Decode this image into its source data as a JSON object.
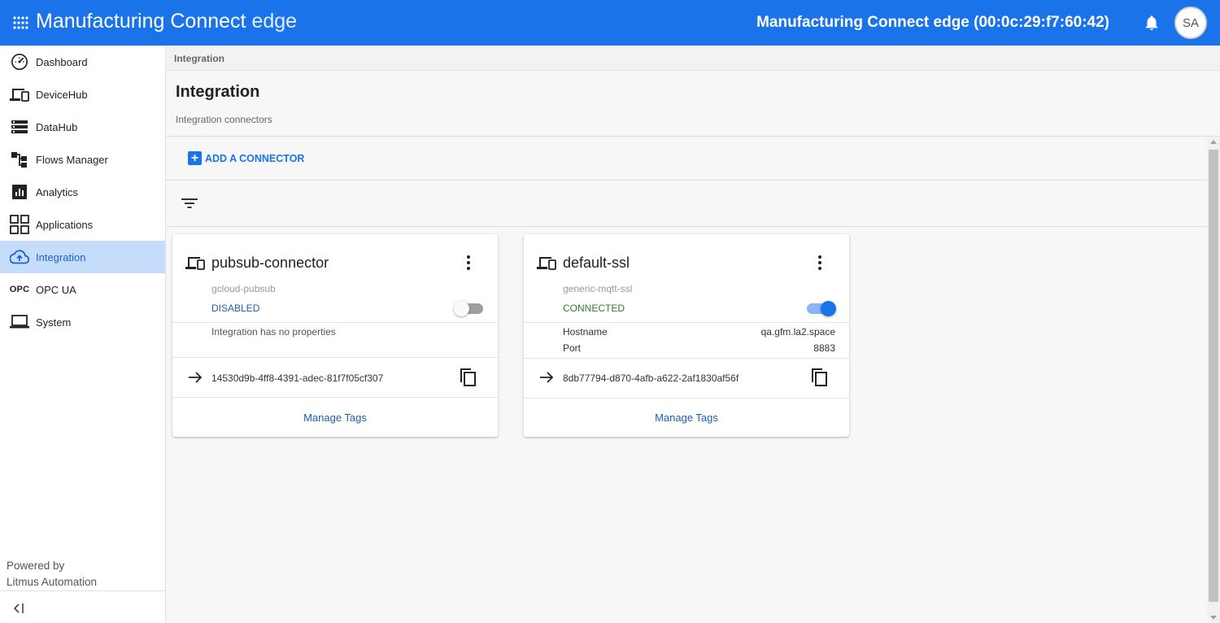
{
  "topbar": {
    "app_title_main": "Manufacturing Connect",
    "app_title_suffix": "edge",
    "device_title": "Manufacturing Connect edge (00:0c:29:f7:60:42)",
    "avatar_initials": "SA",
    "color": "#1a73e8"
  },
  "sidebar": {
    "items": [
      {
        "label": "Dashboard",
        "icon": "speedometer-icon"
      },
      {
        "label": "DeviceHub",
        "icon": "devices-icon"
      },
      {
        "label": "DataHub",
        "icon": "storage-icon"
      },
      {
        "label": "Flows Manager",
        "icon": "flow-icon"
      },
      {
        "label": "Analytics",
        "icon": "analytics-icon"
      },
      {
        "label": "Applications",
        "icon": "apps-grid-icon"
      },
      {
        "label": "Integration",
        "icon": "cloud-upload-icon",
        "active": true
      },
      {
        "label": "OPC UA",
        "icon_text": "OPC"
      },
      {
        "label": "System",
        "icon": "laptop-icon"
      }
    ],
    "powered_by_line1": "Powered by",
    "powered_by_line2": "Litmus Automation"
  },
  "breadcrumb": "Integration",
  "page": {
    "title": "Integration",
    "subtitle": "Integration connectors",
    "add_button_label": "ADD A CONNECTOR"
  },
  "connectors": [
    {
      "name": "pubsub-connector",
      "type": "gcloud-pubsub",
      "status": "DISABLED",
      "enabled": false,
      "no_properties_text": "Integration has no properties",
      "id": "14530d9b-4ff8-4391-adec-81f7f05cf307",
      "manage_label": "Manage Tags"
    },
    {
      "name": "default-ssl",
      "type": "generic-mqtt-ssl",
      "status": "CONNECTED",
      "enabled": true,
      "properties": [
        {
          "key": "Hostname",
          "value": "qa.gfm.la2.space"
        },
        {
          "key": "Port",
          "value": "8883"
        }
      ],
      "id": "8db77794-d870-4afb-a622-2af1830af56f",
      "manage_label": "Manage Tags"
    }
  ]
}
